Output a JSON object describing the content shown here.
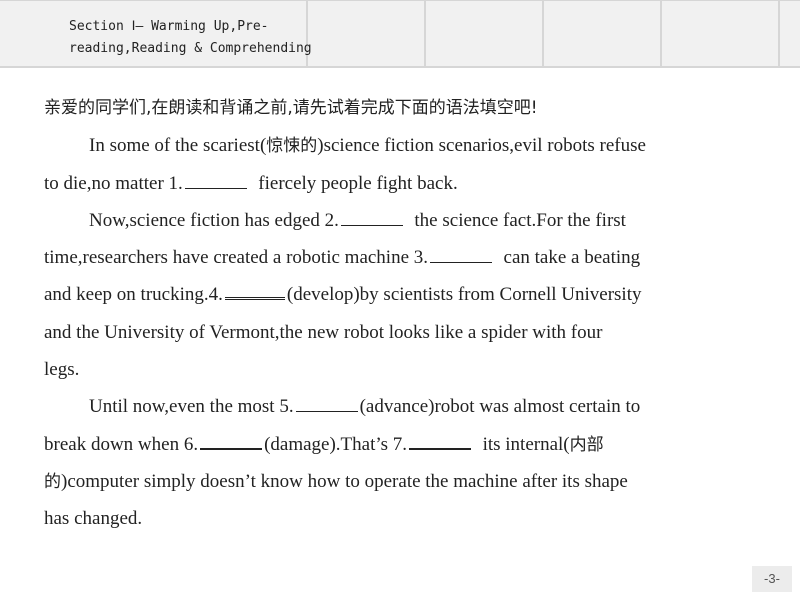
{
  "header": {
    "title": "Section Ⅰ— Warming Up,Pre-reading,Reading & Comprehending"
  },
  "content": {
    "intro": "亲爱的同学们,在朗读和背诵之前,请先试着完成下面的语法填空吧!",
    "p1": {
      "l1a": "In some of the scariest(",
      "l1cn": "惊悚的",
      "l1b": ")science fiction scenarios,evil robots refuse",
      "l2a": "to die,no matter 1.",
      "l2b": "fiercely people fight back."
    },
    "p2": {
      "l1a": "Now,science fiction has edged 2.",
      "l1b": "the science fact.For the first",
      "l2a": "time,researchers have created a robotic machine 3.",
      "l2b": "can take a beating",
      "l3a": "and keep on trucking.4.",
      "l3b": "(develop)by scientists from Cornell University",
      "l4": "and the University of Vermont,the new robot looks like a spider with four",
      "l5": "legs."
    },
    "p3": {
      "l1a": "Until now,even the most 5.",
      "l1b": "(advance)robot was almost certain to",
      "l2a": "break down when 6.",
      "l2b": "(damage).That’s 7.",
      "l2c": "its internal(",
      "l2cn": "内部",
      "l3cn": "的",
      "l3a": ")computer simply doesn’t know how to operate the machine after its shape",
      "l4": "has changed."
    }
  },
  "footer": {
    "page_number": "-3-"
  }
}
